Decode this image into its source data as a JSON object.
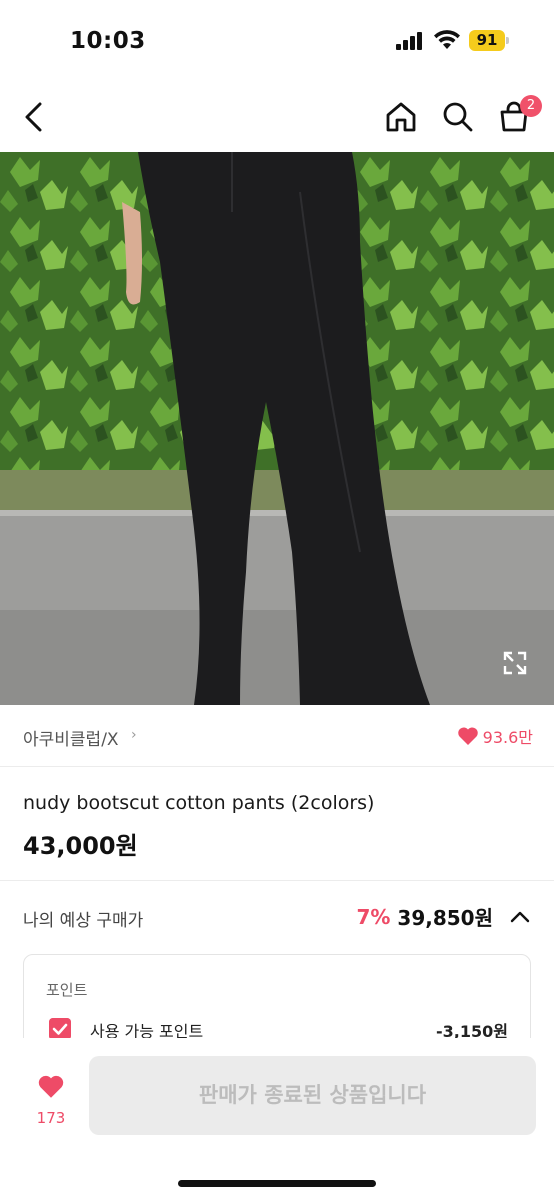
{
  "status_bar": {
    "time": "10:03",
    "battery": "91"
  },
  "nav": {
    "cart_count": "2"
  },
  "product": {
    "brand": "아쿠비클럽/X",
    "brand_chevron": "›",
    "likes": "93.6만",
    "title": "nudy bootscut cotton pants (2colors)",
    "price": "43,000원"
  },
  "estimate": {
    "label": "나의 예상 구매가",
    "discount": "7%",
    "price": "39,850원"
  },
  "points": {
    "title": "포인트",
    "available_label": "사용 가능 포인트",
    "available_value": "-3,150원"
  },
  "bottom_bar": {
    "wish_count": "173",
    "buy_label": "판매가 종료된 상품입니다"
  },
  "colors": {
    "accent": "#ee4b67",
    "disabled_bg": "#ebebeb"
  },
  "icons": [
    "back-icon",
    "home-icon",
    "search-icon",
    "cart-icon",
    "heart-icon",
    "expand-icon",
    "checkbox-checked-icon"
  ]
}
